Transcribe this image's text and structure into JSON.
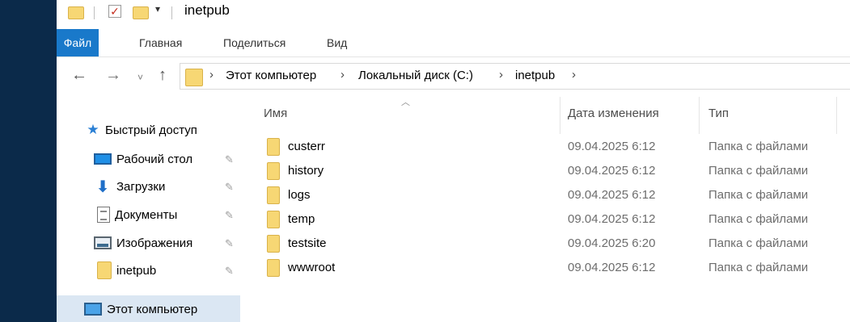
{
  "window": {
    "title": "inetpub"
  },
  "ribbon": {
    "tabs": [
      {
        "label": "Файл",
        "active": true
      },
      {
        "label": "Главная"
      },
      {
        "label": "Поделиться"
      },
      {
        "label": "Вид"
      }
    ]
  },
  "address": {
    "breadcrumbs": [
      "Этот компьютер",
      "Локальный диск (C:)",
      "inetpub"
    ]
  },
  "navpane": {
    "quick_access": "Быстрый доступ",
    "items": [
      {
        "label": "Рабочий стол",
        "icon": "desktop-icon",
        "pinned": true
      },
      {
        "label": "Загрузки",
        "icon": "download-icon",
        "pinned": true
      },
      {
        "label": "Документы",
        "icon": "documents-icon",
        "pinned": true
      },
      {
        "label": "Изображения",
        "icon": "pictures-icon",
        "pinned": true
      },
      {
        "label": "inetpub",
        "icon": "folder-icon",
        "pinned": true
      }
    ],
    "this_pc": "Этот компьютер"
  },
  "content": {
    "columns": {
      "name": "Имя",
      "date": "Дата изменения",
      "type": "Тип"
    },
    "rows": [
      {
        "name": "custerr",
        "date": "09.04.2025 6:12",
        "type": "Папка с файлами"
      },
      {
        "name": "history",
        "date": "09.04.2025 6:12",
        "type": "Папка с файлами"
      },
      {
        "name": "logs",
        "date": "09.04.2025 6:12",
        "type": "Папка с файлами"
      },
      {
        "name": "temp",
        "date": "09.04.2025 6:12",
        "type": "Папка с файлами"
      },
      {
        "name": "testsite",
        "date": "09.04.2025 6:20",
        "type": "Папка с файлами"
      },
      {
        "name": "wwwroot",
        "date": "09.04.2025 6:12",
        "type": "Папка с файлами"
      }
    ]
  },
  "colors": {
    "file_tab": "#1979ca",
    "folder": "#f7d774",
    "selected_nav": "#dbe7f3",
    "desktop_strip": "#0b2a4a"
  }
}
